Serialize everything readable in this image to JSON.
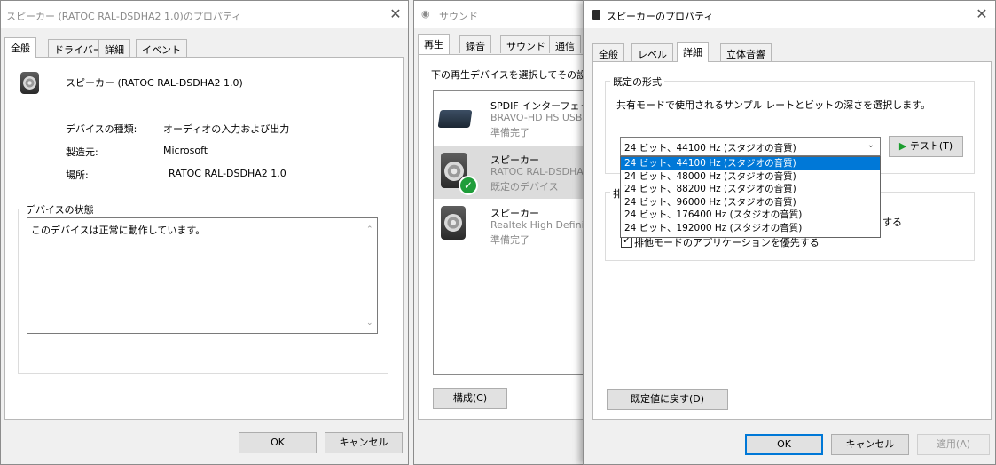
{
  "win1": {
    "title": "スピーカー (RATOC RAL-DSDHA2 1.0)のプロパティ",
    "tabs": [
      "全般",
      "ドライバー",
      "詳細",
      "イベント"
    ],
    "device_name": "スピーカー (RATOC RAL-DSDHA2 1.0)",
    "props": [
      {
        "label": "デバイスの種類:",
        "value": "オーディオの入力および出力"
      },
      {
        "label": "製造元:",
        "value": "Microsoft"
      },
      {
        "label": "場所:",
        "value": "RATOC RAL-DSDHA2 1.0"
      }
    ],
    "status_group": "デバイスの状態",
    "status_text": "このデバイスは正常に動作しています。",
    "ok": "OK",
    "cancel": "キャンセル"
  },
  "win2": {
    "title": "サウンド",
    "tabs": [
      "再生",
      "録音",
      "サウンド",
      "通信"
    ],
    "instruction": "下の再生デバイスを選択してその設定",
    "devices": [
      {
        "name": "SPDIF インターフェイス",
        "desc": "BRAVO-HD HS USB",
        "status": "準備完了"
      },
      {
        "name": "スピーカー",
        "desc": "RATOC RAL-DSDHA",
        "status": "既定のデバイス"
      },
      {
        "name": "スピーカー",
        "desc": "Realtek High Definit",
        "status": "準備完了"
      }
    ],
    "configure": "構成(C)"
  },
  "win3": {
    "title": "スピーカーのプロパティ",
    "tabs": [
      "全般",
      "レベル",
      "詳細",
      "立体音響"
    ],
    "group_label": "既定の形式",
    "group_desc": "共有モードで使用されるサンプル レートとビットの深さを選択します。",
    "selected_format": "24 ビット、44100 Hz (スタジオの音質)",
    "format_options": [
      "24 ビット、44100 Hz (スタジオの音質)",
      "24 ビット、48000 Hz (スタジオの音質)",
      "24 ビット、88200 Hz (スタジオの音質)",
      "24 ビット、96000 Hz (スタジオの音質)",
      "24 ビット、176400 Hz (スタジオの音質)",
      "24 ビット、192000 Hz (スタジオの音質)"
    ],
    "test_button": "テスト(T)",
    "exclusive_group_label_fragment": "排",
    "exclusive_allow_fragment": "する",
    "exclusive_priority": "排他モードのアプリケーションを優先する",
    "exclusive_priority_checked": true,
    "restore_defaults": "既定値に戻す(D)",
    "ok": "OK",
    "cancel": "キャンセル",
    "apply": "適用(A)"
  }
}
